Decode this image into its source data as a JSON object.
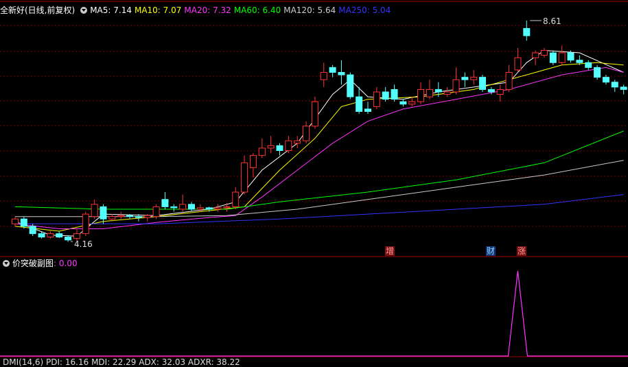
{
  "main_header": {
    "title": "全新好(日线,前复权)",
    "ma": [
      {
        "label": "MA5: 7.14",
        "color": "#ffffff"
      },
      {
        "label": "MA10: 7.07",
        "color": "#ffff00"
      },
      {
        "label": "MA20: 7.32",
        "color": "#ff33ff"
      },
      {
        "label": "MA60: 6.40",
        "color": "#00ff00"
      },
      {
        "label": "MA120: 5.64",
        "color": "#cccccc"
      },
      {
        "label": "MA250: 5.04",
        "color": "#3333ff"
      }
    ]
  },
  "annotations": {
    "high": "8.61",
    "low": "4.16"
  },
  "event_tags": [
    {
      "label": "增",
      "bg": "#7a1010",
      "color": "#ff9999"
    },
    {
      "label": "财",
      "bg": "#103a7a",
      "color": "#99ccff"
    },
    {
      "label": "涨",
      "bg": "#7a1010",
      "color": "#ff9999"
    }
  ],
  "sub_header": {
    "title": "价突破副图",
    "value": ": 0.00",
    "value_color": "#ff33ff"
  },
  "bottom_header": "DMI(14,6)  PDI: 16.16  MDI: 22.29  ADX: 32.03  ADXR: 38.22",
  "colors": {
    "up": "#ff3333",
    "down": "#54ffff",
    "grid": "#7a0000",
    "panel_line": "#a00000"
  },
  "chart_data": {
    "type": "candlestick",
    "price_high": 8.61,
    "price_low": 4.16,
    "candles": [
      [
        4.45,
        4.55,
        4.6,
        4.4
      ],
      [
        4.55,
        4.4,
        4.6,
        4.35
      ],
      [
        4.4,
        4.25,
        4.45,
        4.2
      ],
      [
        4.25,
        4.18,
        4.3,
        4.15
      ],
      [
        4.18,
        4.25,
        4.3,
        4.15
      ],
      [
        4.25,
        4.18,
        4.3,
        4.16
      ],
      [
        4.18,
        4.12,
        4.22,
        4.08
      ],
      [
        4.15,
        4.25,
        4.35,
        4.1
      ],
      [
        4.25,
        4.65,
        4.7,
        4.2
      ],
      [
        4.6,
        4.85,
        4.95,
        4.55
      ],
      [
        4.8,
        4.55,
        4.85,
        4.45
      ],
      [
        4.55,
        4.6,
        4.65,
        4.5
      ],
      [
        4.6,
        4.62,
        4.7,
        4.55
      ],
      [
        4.62,
        4.6,
        4.65,
        4.55
      ],
      [
        4.6,
        4.58,
        4.65,
        4.5
      ],
      [
        4.58,
        4.62,
        4.65,
        4.5
      ],
      [
        4.6,
        4.8,
        4.85,
        4.55
      ],
      [
        4.95,
        4.8,
        5.1,
        4.75
      ],
      [
        4.8,
        4.78,
        4.85,
        4.7
      ],
      [
        4.75,
        4.85,
        5.05,
        4.7
      ],
      [
        4.85,
        4.75,
        4.9,
        4.7
      ],
      [
        4.75,
        4.78,
        4.85,
        4.7
      ],
      [
        4.78,
        4.75,
        4.8,
        4.7
      ],
      [
        4.75,
        4.78,
        4.85,
        4.7
      ],
      [
        4.78,
        4.8,
        4.88,
        4.7
      ],
      [
        4.8,
        5.1,
        5.2,
        4.75
      ],
      [
        5.1,
        5.7,
        5.85,
        5.05
      ],
      [
        5.6,
        5.85,
        5.9,
        5.4
      ],
      [
        5.85,
        6.0,
        6.2,
        5.8
      ],
      [
        6.0,
        6.05,
        6.25,
        5.9
      ],
      [
        6.05,
        5.95,
        6.1,
        5.85
      ],
      [
        5.95,
        6.15,
        6.25,
        5.9
      ],
      [
        6.1,
        6.15,
        6.25,
        6.0
      ],
      [
        6.15,
        6.45,
        6.55,
        6.1
      ],
      [
        6.45,
        6.95,
        7.05,
        6.4
      ],
      [
        7.4,
        7.55,
        7.75,
        7.25
      ],
      [
        7.65,
        7.55,
        7.7,
        7.45
      ],
      [
        7.55,
        7.5,
        7.8,
        7.3
      ],
      [
        7.5,
        7.05,
        7.55,
        7.0
      ],
      [
        7.05,
        6.75,
        7.25,
        6.7
      ],
      [
        6.8,
        6.75,
        6.95,
        6.7
      ],
      [
        6.85,
        7.15,
        7.25,
        6.8
      ],
      [
        7.15,
        7.0,
        7.25,
        6.95
      ],
      [
        7.2,
        7.0,
        7.3,
        6.95
      ],
      [
        6.95,
        6.9,
        7.0,
        6.85
      ],
      [
        6.9,
        6.95,
        7.05,
        6.85
      ],
      [
        6.95,
        7.2,
        7.35,
        6.9
      ],
      [
        7.05,
        7.2,
        7.4,
        7.0
      ],
      [
        7.2,
        7.15,
        7.35,
        7.05
      ],
      [
        7.1,
        7.15,
        7.25,
        7.05
      ],
      [
        7.15,
        7.4,
        7.65,
        7.1
      ],
      [
        7.45,
        7.4,
        7.55,
        7.25
      ],
      [
        7.4,
        7.45,
        7.6,
        7.3
      ],
      [
        7.45,
        7.2,
        7.5,
        7.15
      ],
      [
        7.2,
        7.15,
        7.25,
        7.1
      ],
      [
        7.1,
        7.2,
        7.3,
        6.95
      ],
      [
        7.2,
        7.55,
        7.7,
        7.15
      ],
      [
        7.6,
        7.85,
        8.05,
        7.55
      ],
      [
        8.45,
        8.3,
        8.61,
        8.2
      ],
      [
        7.85,
        7.95,
        8.0,
        7.7
      ],
      [
        7.9,
        8.0,
        8.05,
        7.85
      ],
      [
        7.95,
        7.75,
        8.0,
        7.7
      ],
      [
        7.75,
        7.95,
        8.1,
        7.7
      ],
      [
        7.95,
        7.8,
        8.0,
        7.75
      ],
      [
        7.8,
        7.75,
        7.9,
        7.7
      ],
      [
        7.75,
        7.65,
        7.8,
        7.6
      ],
      [
        7.65,
        7.45,
        7.7,
        7.4
      ],
      [
        7.45,
        7.35,
        7.5,
        7.3
      ],
      [
        7.35,
        7.25,
        7.4,
        7.15
      ],
      [
        7.25,
        7.2,
        7.3,
        7.1
      ]
    ],
    "ma_lines": [
      {
        "name": "MA5",
        "color": "#ffffff",
        "points": [
          [
            0,
            4.5
          ],
          [
            4,
            4.22
          ],
          [
            7,
            4.2
          ],
          [
            10,
            4.65
          ],
          [
            16,
            4.62
          ],
          [
            22,
            4.75
          ],
          [
            25,
            4.9
          ],
          [
            28,
            5.55
          ],
          [
            32,
            6.1
          ],
          [
            36,
            7.1
          ],
          [
            38,
            7.4
          ],
          [
            40,
            7.05
          ],
          [
            44,
            7.0
          ],
          [
            48,
            7.15
          ],
          [
            52,
            7.25
          ],
          [
            56,
            7.35
          ],
          [
            58,
            7.75
          ],
          [
            60,
            8.0
          ],
          [
            64,
            7.95
          ],
          [
            69,
            7.55
          ]
        ]
      },
      {
        "name": "MA10",
        "color": "#ffff00",
        "points": [
          [
            0,
            4.4
          ],
          [
            5,
            4.3
          ],
          [
            10,
            4.5
          ],
          [
            16,
            4.6
          ],
          [
            22,
            4.72
          ],
          [
            26,
            4.8
          ],
          [
            30,
            5.55
          ],
          [
            34,
            6.2
          ],
          [
            37,
            6.85
          ],
          [
            40,
            7.0
          ],
          [
            46,
            7.05
          ],
          [
            52,
            7.2
          ],
          [
            58,
            7.5
          ],
          [
            62,
            7.7
          ],
          [
            66,
            7.75
          ],
          [
            69,
            7.7
          ]
        ]
      },
      {
        "name": "MA20",
        "color": "#ff33ff",
        "points": [
          [
            0,
            4.45
          ],
          [
            5,
            4.35
          ],
          [
            10,
            4.35
          ],
          [
            16,
            4.48
          ],
          [
            22,
            4.58
          ],
          [
            25,
            4.62
          ],
          [
            28,
            5.0
          ],
          [
            32,
            5.55
          ],
          [
            36,
            6.1
          ],
          [
            40,
            6.55
          ],
          [
            44,
            6.8
          ],
          [
            50,
            7.0
          ],
          [
            56,
            7.2
          ],
          [
            62,
            7.5
          ],
          [
            67,
            7.65
          ],
          [
            69,
            7.55
          ]
        ]
      },
      {
        "name": "MA60",
        "color": "#00ff00",
        "points": [
          [
            0,
            4.8
          ],
          [
            10,
            4.75
          ],
          [
            16,
            4.75
          ],
          [
            24,
            4.75
          ],
          [
            30,
            4.9
          ],
          [
            40,
            5.1
          ],
          [
            50,
            5.35
          ],
          [
            60,
            5.7
          ],
          [
            69,
            6.35
          ]
        ]
      },
      {
        "name": "MA120",
        "color": "#cccccc",
        "points": [
          [
            0,
            4.6
          ],
          [
            16,
            4.6
          ],
          [
            24,
            4.62
          ],
          [
            32,
            4.75
          ],
          [
            40,
            4.95
          ],
          [
            50,
            5.2
          ],
          [
            60,
            5.45
          ],
          [
            69,
            5.75
          ]
        ]
      },
      {
        "name": "MA250",
        "color": "#3333ff",
        "points": [
          [
            0,
            4.45
          ],
          [
            16,
            4.45
          ],
          [
            30,
            4.55
          ],
          [
            40,
            4.65
          ],
          [
            50,
            4.75
          ],
          [
            60,
            4.85
          ],
          [
            69,
            5.05
          ]
        ]
      }
    ],
    "indicator": {
      "spike_index": 57,
      "spike_value": 1.0
    }
  }
}
